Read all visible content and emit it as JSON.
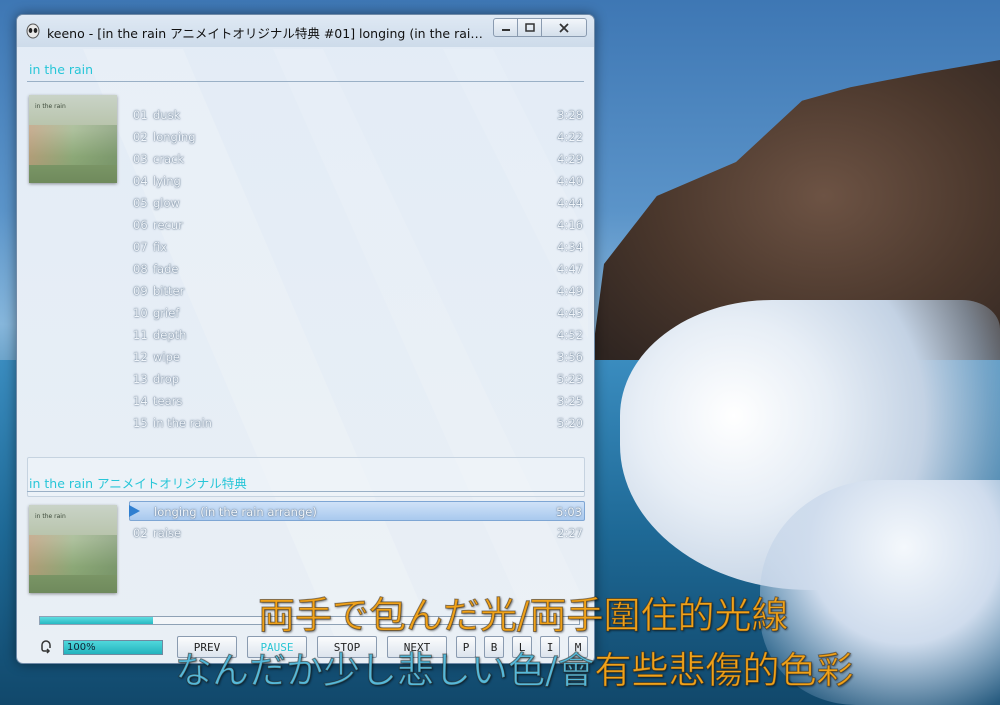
{
  "window": {
    "title": "keeno - [in the rain アニメイトオリジナル特典 #01] longing (in the rain arra..."
  },
  "albums": [
    {
      "title": "in the rain",
      "art_caption": "in the rain",
      "tracks": [
        {
          "num": "01",
          "name": "dusk",
          "time": "3:28"
        },
        {
          "num": "02",
          "name": "longing",
          "time": "4:22"
        },
        {
          "num": "03",
          "name": "crack",
          "time": "4:29"
        },
        {
          "num": "04",
          "name": "lying",
          "time": "4:40"
        },
        {
          "num": "05",
          "name": "glow",
          "time": "4:44"
        },
        {
          "num": "06",
          "name": "recur",
          "time": "4:16"
        },
        {
          "num": "07",
          "name": "fix",
          "time": "4:34"
        },
        {
          "num": "08",
          "name": "fade",
          "time": "4:47"
        },
        {
          "num": "09",
          "name": "bitter",
          "time": "4:49"
        },
        {
          "num": "10",
          "name": "grief",
          "time": "4:43"
        },
        {
          "num": "11",
          "name": "depth",
          "time": "4:52"
        },
        {
          "num": "12",
          "name": "wipe",
          "time": "3:56"
        },
        {
          "num": "13",
          "name": "drop",
          "time": "5:23"
        },
        {
          "num": "14",
          "name": "tears",
          "time": "3:25"
        },
        {
          "num": "15",
          "name": "in the rain",
          "time": "5:20"
        }
      ]
    },
    {
      "title": "in the rain アニメイトオリジナル特典",
      "art_caption": "in the rain",
      "tracks": [
        {
          "num": "",
          "name": "longing (in the rain arrange)",
          "time": "5:03",
          "selected": true
        },
        {
          "num": "02",
          "name": "raise",
          "time": "2:27"
        }
      ]
    }
  ],
  "playback": {
    "progress": 0.21,
    "volume_label": "100%",
    "volume": 1.0
  },
  "controls": {
    "prev": "PREV",
    "pause": "PAUSE",
    "stop": "STOP",
    "next": "NEXT",
    "p": "P",
    "b": "B",
    "l": "L",
    "i": "I",
    "m": "M"
  },
  "lyrics": {
    "line1": "両手で包んだ光/両手圍住的光線",
    "line2_jp": "なんだか少し悲しい色/會",
    "line2_cn": "有些悲傷的色彩"
  },
  "colors": {
    "accent": "#28c6d8",
    "lyric_orange": "#f0a21a",
    "lyric_blue": "#56b9da"
  }
}
